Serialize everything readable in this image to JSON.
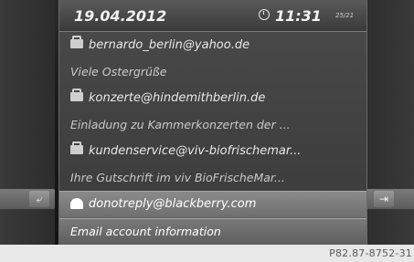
{
  "header": {
    "date": "19.04.2012",
    "time": "11:31",
    "counter": "25/21"
  },
  "messages": [
    {
      "sender": "bernardo_berlin@yahoo.de",
      "subject": "Viele Ostergrüße"
    },
    {
      "sender": "konzerte@hindemithberlin.de",
      "subject": "Einladung zu Kammerkonzerten der ..."
    },
    {
      "sender": "kundenservice@viv-biofrischemar...",
      "subject": "Ihre Gutschrift im viv BioFrischeMar..."
    },
    {
      "sender": "donotreply@blackberry.com",
      "subject": "Email account information"
    }
  ],
  "selected_index": 3,
  "nav": {
    "back_symbol": "⤶",
    "next_symbol": "⇥"
  },
  "footer": {
    "reference": "P82.87-8752-31"
  }
}
